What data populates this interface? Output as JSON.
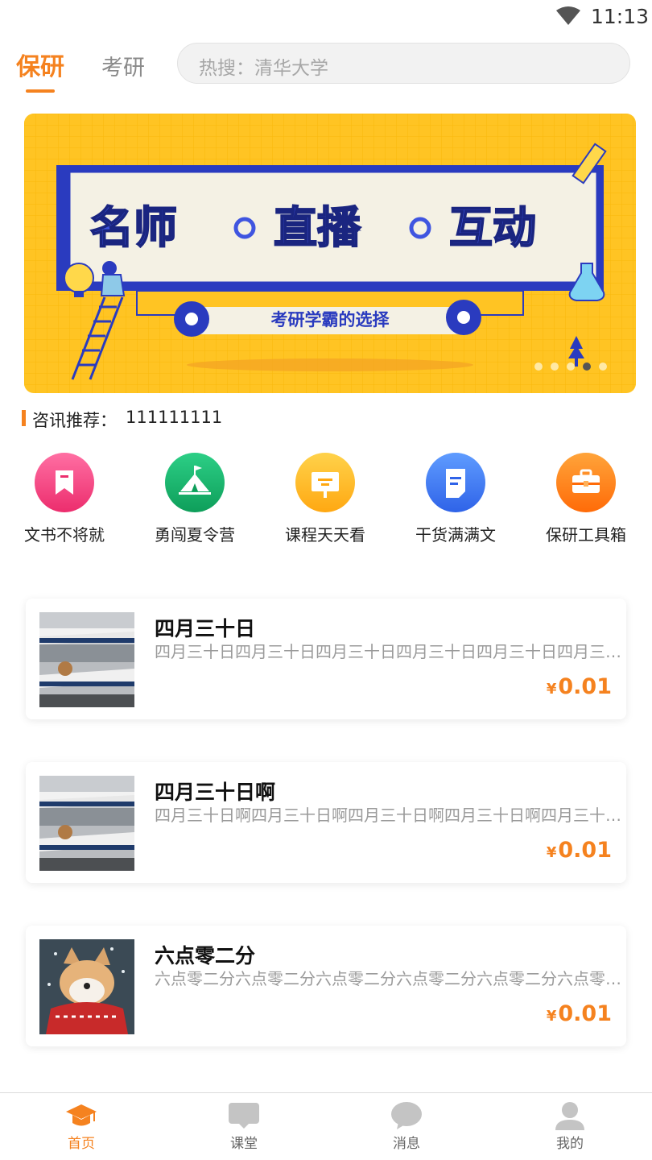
{
  "status_bar": {
    "time": "11:13",
    "wifi_icon": "wifi-icon"
  },
  "header": {
    "tabs": [
      {
        "label": "保研",
        "active": true
      },
      {
        "label": "考研",
        "active": false
      }
    ],
    "search_placeholder": "热搜：清华大学"
  },
  "banner": {
    "headline_parts": [
      "名师",
      "直播",
      "互动"
    ],
    "subline": "考研学霸的选择",
    "page_count": 5,
    "active_index": 3,
    "colors": {
      "background": "#ffc423",
      "frame": "#2a3bbf"
    }
  },
  "news": {
    "label": "咨讯推荐：",
    "value": "111111111"
  },
  "quick_links": [
    {
      "label": "文书不将就",
      "icon": "bookmark-icon",
      "color": "#f0467f"
    },
    {
      "label": "勇闯夏令营",
      "icon": "tent-icon",
      "color": "#17b26b"
    },
    {
      "label": "课程天天看",
      "icon": "board-icon",
      "color": "#ffb71d"
    },
    {
      "label": "干货满满文",
      "icon": "document-icon",
      "color": "#3f7ff5"
    },
    {
      "label": "保研工具箱",
      "icon": "toolbox-icon",
      "color": "#ff7a10"
    }
  ],
  "cards": [
    {
      "title": "四月三十日",
      "description": "四月三十日四月三十日四月三十日四月三十日四月三十日四月三十日四月三十日",
      "currency": "¥",
      "price": "0.01",
      "image": "airplane-thumbnail"
    },
    {
      "title": "四月三十日啊",
      "description": "四月三十日啊四月三十日啊四月三十日啊四月三十日啊四月三十日啊四月三十日啊",
      "currency": "¥",
      "price": "0.01",
      "image": "airplane-thumbnail"
    },
    {
      "title": "六点零二分",
      "description": "六点零二分六点零二分六点零二分六点零二分六点零二分六点零二分六点零二分",
      "currency": "¥",
      "price": "0.01",
      "image": "dog-thumbnail"
    }
  ],
  "tabbar": [
    {
      "label": "首页",
      "icon": "graduation-cap-icon",
      "active": true
    },
    {
      "label": "课堂",
      "icon": "classroom-icon",
      "active": false
    },
    {
      "label": "消息",
      "icon": "message-icon",
      "active": false
    },
    {
      "label": "我的",
      "icon": "user-icon",
      "active": false
    }
  ],
  "colors": {
    "accent": "#f5821f",
    "muted_text": "#9a9a9a",
    "inactive_icon": "#c4c4c4"
  }
}
